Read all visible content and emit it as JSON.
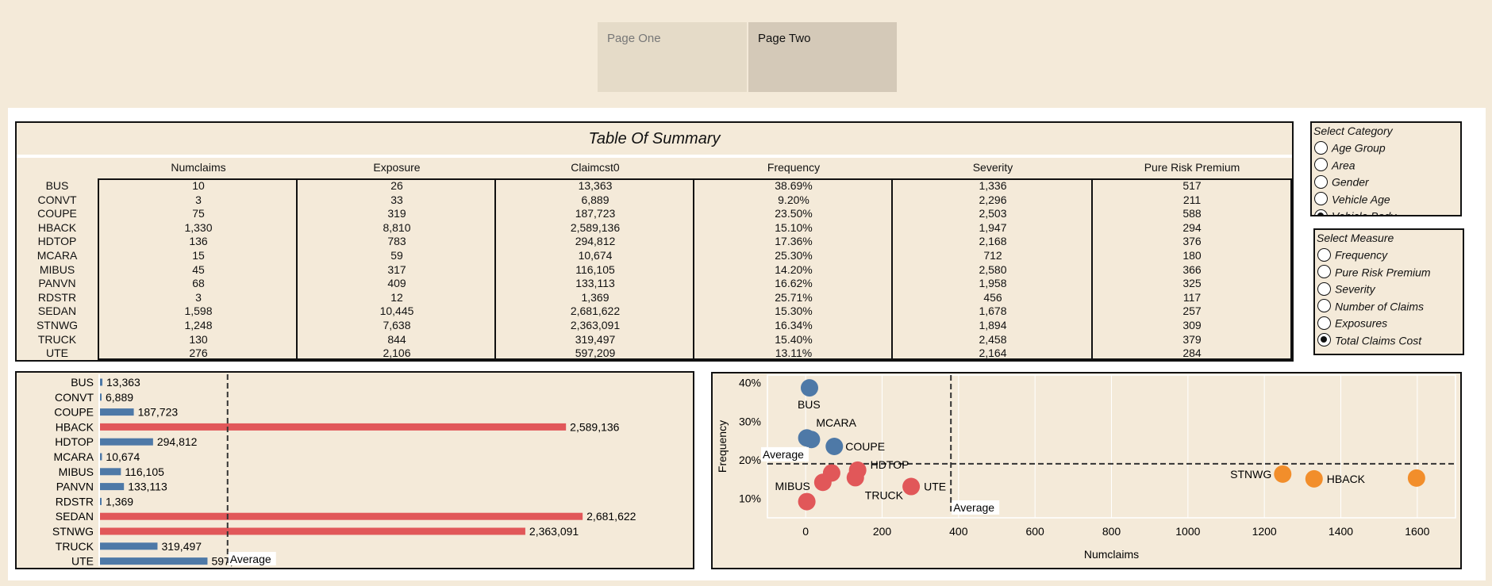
{
  "tabs": [
    {
      "label": "Page One"
    },
    {
      "label": "Page Two"
    }
  ],
  "summary": {
    "title": "Table Of Summary",
    "columns": [
      "Numclaims",
      "Exposure",
      "Claimcst0",
      "Frequency",
      "Severity",
      "Pure Risk Premium"
    ],
    "rows": [
      {
        "label": "BUS",
        "values": [
          "10",
          "26",
          "13,363",
          "38.69%",
          "1,336",
          "517"
        ]
      },
      {
        "label": "CONVT",
        "values": [
          "3",
          "33",
          "6,889",
          "9.20%",
          "2,296",
          "211"
        ]
      },
      {
        "label": "COUPE",
        "values": [
          "75",
          "319",
          "187,723",
          "23.50%",
          "2,503",
          "588"
        ]
      },
      {
        "label": "HBACK",
        "values": [
          "1,330",
          "8,810",
          "2,589,136",
          "15.10%",
          "1,947",
          "294"
        ]
      },
      {
        "label": "HDTOP",
        "values": [
          "136",
          "783",
          "294,812",
          "17.36%",
          "2,168",
          "376"
        ]
      },
      {
        "label": "MCARA",
        "values": [
          "15",
          "59",
          "10,674",
          "25.30%",
          "712",
          "180"
        ]
      },
      {
        "label": "MIBUS",
        "values": [
          "45",
          "317",
          "116,105",
          "14.20%",
          "2,580",
          "366"
        ]
      },
      {
        "label": "PANVN",
        "values": [
          "68",
          "409",
          "133,113",
          "16.62%",
          "1,958",
          "325"
        ]
      },
      {
        "label": "RDSTR",
        "values": [
          "3",
          "12",
          "1,369",
          "25.71%",
          "456",
          "117"
        ]
      },
      {
        "label": "SEDAN",
        "values": [
          "1,598",
          "10,445",
          "2,681,622",
          "15.30%",
          "1,678",
          "257"
        ]
      },
      {
        "label": "STNWG",
        "values": [
          "1,248",
          "7,638",
          "2,363,091",
          "16.34%",
          "1,894",
          "309"
        ]
      },
      {
        "label": "TRUCK",
        "values": [
          "130",
          "844",
          "319,497",
          "15.40%",
          "2,458",
          "379"
        ]
      },
      {
        "label": "UTE",
        "values": [
          "276",
          "2,106",
          "597,209",
          "13.11%",
          "2,164",
          "284"
        ]
      }
    ]
  },
  "category_filter": {
    "title": "Select Category",
    "options": [
      {
        "label": "Age Group",
        "selected": false
      },
      {
        "label": "Area",
        "selected": false
      },
      {
        "label": "Gender",
        "selected": false
      },
      {
        "label": "Vehicle Age",
        "selected": false
      },
      {
        "label": "Vehicle Body",
        "selected": true
      }
    ]
  },
  "measure_filter": {
    "title": "Select Measure",
    "options": [
      {
        "label": "Frequency",
        "selected": false
      },
      {
        "label": "Pure Risk Premium",
        "selected": false
      },
      {
        "label": "Severity",
        "selected": false
      },
      {
        "label": "Number of Claims",
        "selected": false
      },
      {
        "label": "Exposures",
        "selected": false
      },
      {
        "label": "Total Claims Cost",
        "selected": true
      }
    ]
  },
  "colors": {
    "blue": "#4e79a7",
    "red": "#e15759",
    "orange": "#f28e2b",
    "background": "#f4ead9"
  },
  "chart_data": [
    {
      "type": "bar",
      "orientation": "horizontal",
      "categories": [
        "BUS",
        "CONVT",
        "COUPE",
        "HBACK",
        "HDTOP",
        "MCARA",
        "MIBUS",
        "PANVN",
        "RDSTR",
        "SEDAN",
        "STNWG",
        "TRUCK",
        "UTE"
      ],
      "values": [
        13363,
        6889,
        187723,
        2589136,
        294812,
        10674,
        116105,
        133113,
        1369,
        2681622,
        2363091,
        319497,
        597209
      ],
      "value_labels": [
        "13,363",
        "6,889",
        "187,723",
        "2,589,136",
        "294,812",
        "10,674",
        "116,105",
        "133,113",
        "1,369",
        "2,681,622",
        "2,363,091",
        "319,497",
        "597,209"
      ],
      "color_groups": [
        "blue",
        "blue",
        "blue",
        "red",
        "blue",
        "blue",
        "blue",
        "blue",
        "blue",
        "red",
        "red",
        "blue",
        "blue"
      ],
      "reference_line": {
        "label": "Average",
        "value": 708846
      },
      "xlim": [
        0,
        2800000
      ]
    },
    {
      "type": "scatter",
      "xlabel": "Numclaims",
      "ylabel": "Frequency",
      "xlim": [
        -100,
        1700
      ],
      "ylim": [
        0.05,
        0.42
      ],
      "xticks": [
        0,
        200,
        400,
        600,
        800,
        1000,
        1200,
        1400,
        1600
      ],
      "yticks": [
        0.1,
        0.2,
        0.3,
        0.4
      ],
      "ytick_labels": [
        "10%",
        "20%",
        "30%",
        "40%"
      ],
      "points": [
        {
          "label": "BUS",
          "x": 10,
          "y": 0.3869,
          "color": "blue"
        },
        {
          "label": "CONVT",
          "x": 3,
          "y": 0.092,
          "color": "red"
        },
        {
          "label": "COUPE",
          "x": 75,
          "y": 0.235,
          "color": "blue"
        },
        {
          "label": "HBACK",
          "x": 1330,
          "y": 0.151,
          "color": "orange"
        },
        {
          "label": "HDTOP",
          "x": 136,
          "y": 0.1736,
          "color": "red"
        },
        {
          "label": "MCARA",
          "x": 15,
          "y": 0.253,
          "color": "blue"
        },
        {
          "label": "MIBUS",
          "x": 45,
          "y": 0.142,
          "color": "red"
        },
        {
          "label": "PANVN",
          "x": 68,
          "y": 0.1662,
          "color": "red"
        },
        {
          "label": "RDSTR",
          "x": 3,
          "y": 0.2571,
          "color": "blue"
        },
        {
          "label": "SEDAN",
          "x": 1598,
          "y": 0.153,
          "color": "orange"
        },
        {
          "label": "STNWG",
          "x": 1248,
          "y": 0.1634,
          "color": "orange"
        },
        {
          "label": "TRUCK",
          "x": 130,
          "y": 0.154,
          "color": "red"
        },
        {
          "label": "UTE",
          "x": 276,
          "y": 0.1311,
          "color": "red"
        }
      ],
      "visible_labels": [
        "BUS",
        "MCARA",
        "COUPE",
        "HDTOP",
        "MIBUS",
        "TRUCK",
        "UTE",
        "STNWG",
        "HBACK"
      ],
      "reference_lines": [
        {
          "axis": "y",
          "value": 0.19,
          "label": "Average"
        },
        {
          "axis": "x",
          "value": 380,
          "label": "Average"
        }
      ]
    }
  ]
}
